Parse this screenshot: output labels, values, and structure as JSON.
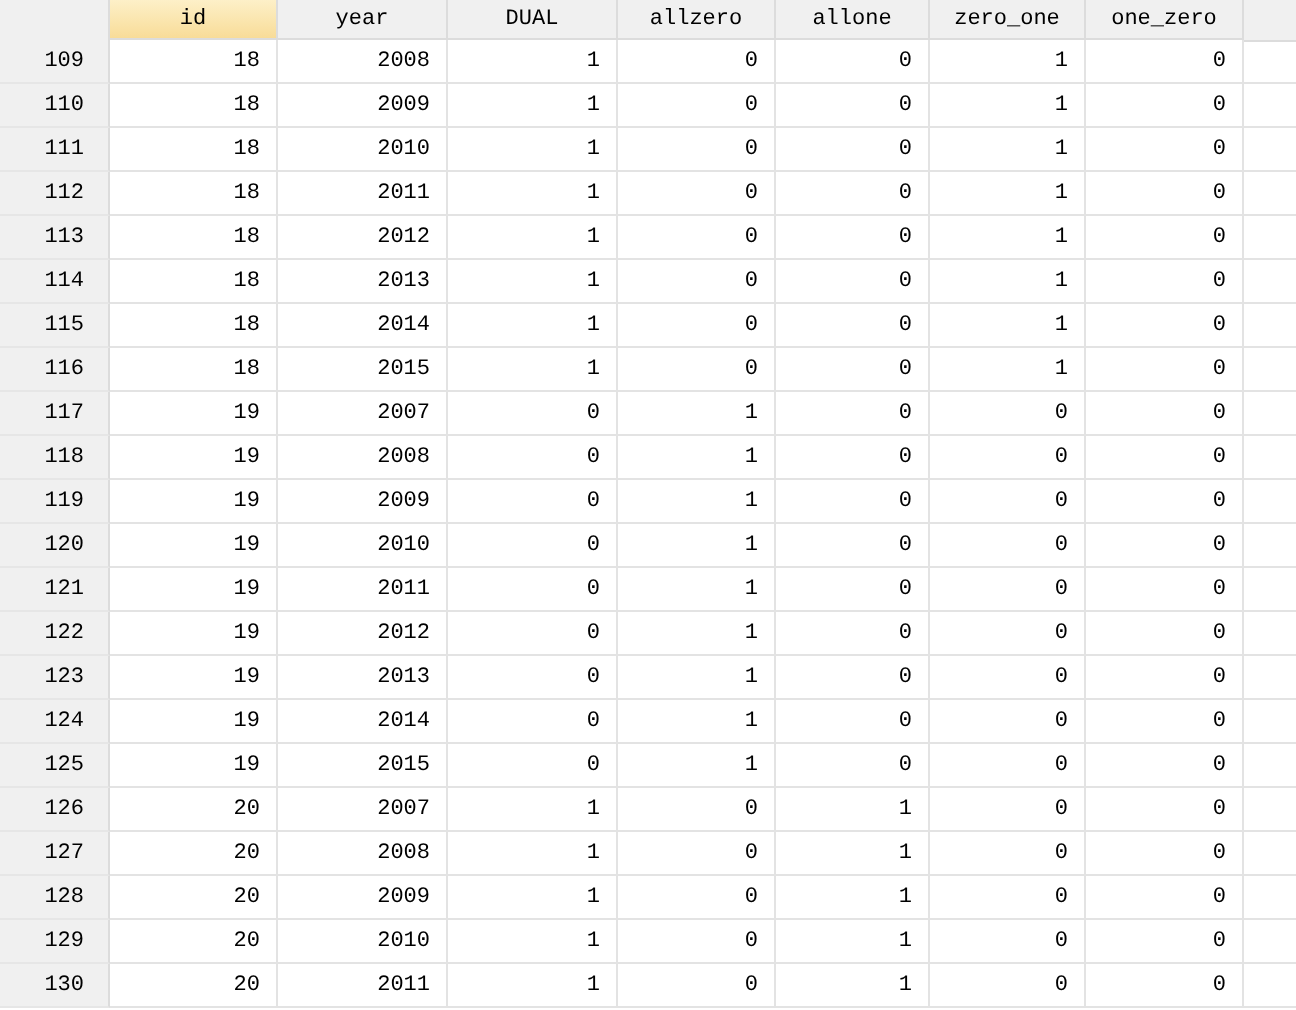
{
  "columns": [
    {
      "label": "id",
      "selected": true
    },
    {
      "label": "year",
      "selected": false
    },
    {
      "label": "DUAL",
      "selected": false
    },
    {
      "label": "allzero",
      "selected": false
    },
    {
      "label": "allone",
      "selected": false
    },
    {
      "label": "zero_one",
      "selected": false
    },
    {
      "label": "one_zero",
      "selected": false
    }
  ],
  "rows": [
    {
      "number": "109",
      "cells": [
        "18",
        "2008",
        "1",
        "0",
        "0",
        "1",
        "0"
      ]
    },
    {
      "number": "110",
      "cells": [
        "18",
        "2009",
        "1",
        "0",
        "0",
        "1",
        "0"
      ]
    },
    {
      "number": "111",
      "cells": [
        "18",
        "2010",
        "1",
        "0",
        "0",
        "1",
        "0"
      ]
    },
    {
      "number": "112",
      "cells": [
        "18",
        "2011",
        "1",
        "0",
        "0",
        "1",
        "0"
      ]
    },
    {
      "number": "113",
      "cells": [
        "18",
        "2012",
        "1",
        "0",
        "0",
        "1",
        "0"
      ]
    },
    {
      "number": "114",
      "cells": [
        "18",
        "2013",
        "1",
        "0",
        "0",
        "1",
        "0"
      ]
    },
    {
      "number": "115",
      "cells": [
        "18",
        "2014",
        "1",
        "0",
        "0",
        "1",
        "0"
      ]
    },
    {
      "number": "116",
      "cells": [
        "18",
        "2015",
        "1",
        "0",
        "0",
        "1",
        "0"
      ]
    },
    {
      "number": "117",
      "cells": [
        "19",
        "2007",
        "0",
        "1",
        "0",
        "0",
        "0"
      ]
    },
    {
      "number": "118",
      "cells": [
        "19",
        "2008",
        "0",
        "1",
        "0",
        "0",
        "0"
      ]
    },
    {
      "number": "119",
      "cells": [
        "19",
        "2009",
        "0",
        "1",
        "0",
        "0",
        "0"
      ]
    },
    {
      "number": "120",
      "cells": [
        "19",
        "2010",
        "0",
        "1",
        "0",
        "0",
        "0"
      ]
    },
    {
      "number": "121",
      "cells": [
        "19",
        "2011",
        "0",
        "1",
        "0",
        "0",
        "0"
      ]
    },
    {
      "number": "122",
      "cells": [
        "19",
        "2012",
        "0",
        "1",
        "0",
        "0",
        "0"
      ]
    },
    {
      "number": "123",
      "cells": [
        "19",
        "2013",
        "0",
        "1",
        "0",
        "0",
        "0"
      ]
    },
    {
      "number": "124",
      "cells": [
        "19",
        "2014",
        "0",
        "1",
        "0",
        "0",
        "0"
      ]
    },
    {
      "number": "125",
      "cells": [
        "19",
        "2015",
        "0",
        "1",
        "0",
        "0",
        "0"
      ]
    },
    {
      "number": "126",
      "cells": [
        "20",
        "2007",
        "1",
        "0",
        "1",
        "0",
        "0"
      ]
    },
    {
      "number": "127",
      "cells": [
        "20",
        "2008",
        "1",
        "0",
        "1",
        "0",
        "0"
      ]
    },
    {
      "number": "128",
      "cells": [
        "20",
        "2009",
        "1",
        "0",
        "1",
        "0",
        "0"
      ]
    },
    {
      "number": "129",
      "cells": [
        "20",
        "2010",
        "1",
        "0",
        "1",
        "0",
        "0"
      ]
    },
    {
      "number": "130",
      "cells": [
        "20",
        "2011",
        "1",
        "0",
        "1",
        "0",
        "0"
      ]
    }
  ]
}
